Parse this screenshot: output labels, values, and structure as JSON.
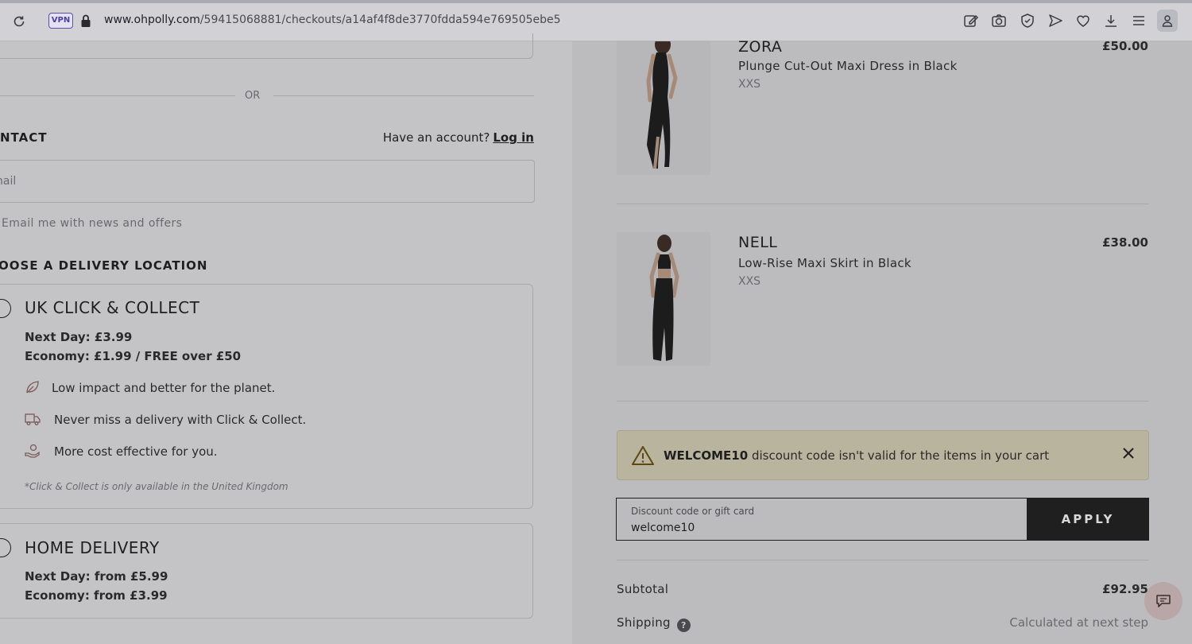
{
  "browser": {
    "vpn_label": "VPN",
    "url_domain": "www.ohpolly.com",
    "url_path": "/59415068881/checkouts/a14af4f8de3770fdda594e769505ebe5"
  },
  "checkout": {
    "or_label": "OR",
    "contact_title": "NTACT",
    "have_account": "Have an account?",
    "login_label": "Log in",
    "email_placeholder": "nail",
    "news_label": "Email me with news and offers",
    "delivery_title": "OOSE A DELIVERY LOCATION",
    "options": [
      {
        "title": "UK CLICK & COLLECT",
        "lines": [
          "Next Day: £3.99",
          "Economy: £1.99 / FREE over £50"
        ],
        "perks": [
          {
            "icon": "leaf-icon",
            "text": "Low impact and better for the planet."
          },
          {
            "icon": "truck-icon",
            "text": "Never miss a delivery with Click & Collect."
          },
          {
            "icon": "money-hand-icon",
            "text": "More cost effective for you."
          }
        ],
        "note": "*Click & Collect is only available in the United Kingdom"
      },
      {
        "title": "HOME DELIVERY",
        "lines": [
          "Next Day: from £5.99",
          "Economy: from £3.99"
        ]
      }
    ]
  },
  "cart": {
    "items": [
      {
        "brand": "ZORA",
        "name": "Plunge Cut-Out Maxi Dress in Black",
        "size": "XXS",
        "price": "£50.00"
      },
      {
        "brand": "NELL",
        "name": "Low-Rise Maxi Skirt in Black",
        "size": "XXS",
        "price": "£38.00"
      }
    ],
    "alert": {
      "code": "WELCOME10",
      "message": "discount code isn't valid for the items in your cart"
    },
    "discount": {
      "label": "Discount code or gift card",
      "value": "welcome10",
      "apply_label": "APPLY"
    },
    "summary": {
      "subtotal_label": "Subtotal",
      "subtotal_value": "£92.95",
      "shipping_label": "Shipping",
      "shipping_value": "Calculated at next step",
      "help_glyph": "?"
    }
  },
  "colors": {
    "overlay_bg": "#c4c4c6",
    "alert_bg": "#b9b49e",
    "button_bg": "#1f1f1f"
  }
}
